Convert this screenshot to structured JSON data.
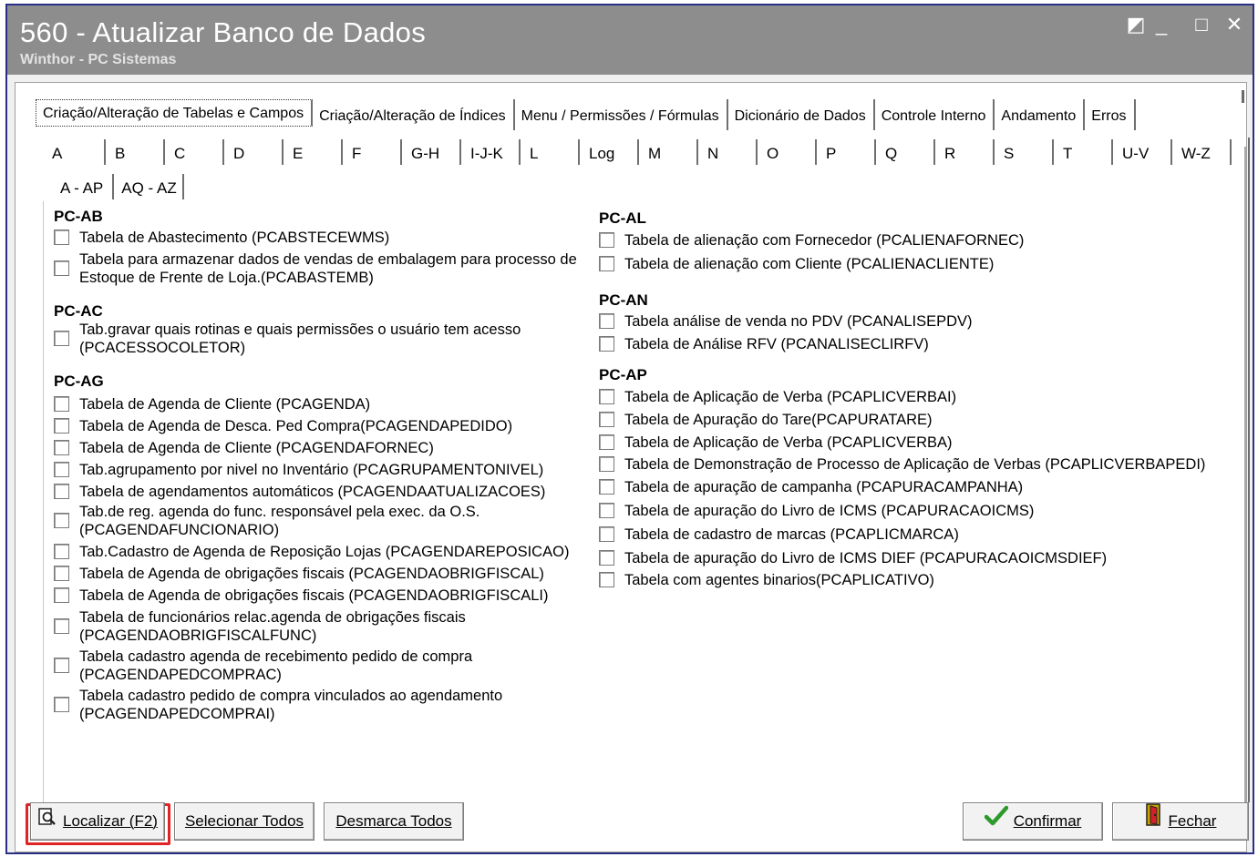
{
  "window": {
    "title": "560 - Atualizar Banco de Dados",
    "subtitle": "Winthor - PC Sistemas",
    "controls": {
      "restore": "◩",
      "minimize": "_",
      "maximize": "□",
      "close": "✕"
    }
  },
  "main_tabs": [
    "Criação/Alteração de Tabelas e Campos",
    "Criação/Alteração de Índices",
    "Menu / Permissões / Fórmulas",
    "Dicionário de Dados",
    "Controle Interno",
    "Andamento",
    "Erros"
  ],
  "letter_tabs": [
    "A",
    "B",
    "C",
    "D",
    "E",
    "F",
    "G-H",
    "I-J-K",
    "L",
    "Log",
    "M",
    "N",
    "O",
    "P",
    "Q",
    "R",
    "S",
    "T",
    "U-V",
    "W-Z"
  ],
  "sub_tabs": [
    "A - AP",
    "AQ - AZ"
  ],
  "groups": {
    "pcab": {
      "title": "PC-AB",
      "items": [
        "Tabela de Abastecimento (PCABSTECEWMS)",
        "Tabela para armazenar dados de vendas de embalagem para processo de Estoque de Frente de Loja.(PCABASTEMB)"
      ]
    },
    "pcac": {
      "title": "PC-AC",
      "items": [
        "Tab.gravar quais rotinas e quais permissões o usuário tem acesso (PCACESSOCOLETOR)"
      ]
    },
    "pcag": {
      "title": "PC-AG",
      "items": [
        "Tabela  de Agenda de Cliente (PCAGENDA)",
        "Tabela  de Agenda de Desca. Ped Compra(PCAGENDAPEDIDO)",
        "Tabela  de Agenda de Cliente (PCAGENDAFORNEC)",
        "Tab.agrupamento por nivel no Inventário (PCAGRUPAMENTONIVEL)",
        "Tabela de agendamentos automáticos (PCAGENDAATUALIZACOES)",
        "Tab.de reg. agenda do func. responsável pela exec. da O.S. (PCAGENDAFUNCIONARIO)",
        "Tab.Cadastro de Agenda de Reposição Lojas (PCAGENDAREPOSICAO)",
        "Tabela de Agenda de obrigações fiscais (PCAGENDAOBRIGFISCAL)",
        "Tabela de Agenda de obrigações fiscais (PCAGENDAOBRIGFISCALI)",
        "Tabela de funcionários relac.agenda de obrigações fiscais (PCAGENDAOBRIGFISCALFUNC)",
        "Tabela cadastro agenda de recebimento pedido de compra (PCAGENDAPEDCOMPRAC)",
        "Tabela cadastro pedido de compra vinculados ao agendamento (PCAGENDAPEDCOMPRAI)"
      ]
    },
    "pcal": {
      "title": "PC-AL",
      "items": [
        "Tabela de alienação com Fornecedor (PCALIENAFORNEC)",
        "Tabela de alienação com Cliente (PCALIENACLIENTE)"
      ]
    },
    "pcan": {
      "title": "PC-AN",
      "items": [
        "Tabela análise de venda no PDV (PCANALISEPDV)",
        "Tabela de Análise RFV (PCANALISECLIRFV)"
      ]
    },
    "pcap": {
      "title": "PC-AP",
      "items": [
        "Tabela de Aplicação de Verba (PCAPLICVERBAI)",
        "Tabela de Apuração do Tare(PCAPURATARE)",
        "Tabela de Aplicação de Verba (PCAPLICVERBA)",
        "Tabela de Demonstração de Processo de Aplicação de Verbas (PCAPLICVERBAPEDI)",
        "Tabela de apuração de campanha (PCAPURACAMPANHA)",
        "Tabela de apuração do Livro de ICMS (PCAPURACAOICMS)",
        "Tabela de cadastro de marcas (PCAPLICMARCA)",
        "Tabela de apuração do Livro de ICMS DIEF (PCAPURACAOICMSDIEF)",
        "Tabela com agentes binarios(PCAPLICATIVO)"
      ]
    }
  },
  "buttons": {
    "localizar": "Localizar (F2)",
    "selecionar": "Selecionar Todos",
    "desmarca": "Desmarca Todos",
    "confirmar": "Confirmar",
    "fechar": "Fechar"
  },
  "icons": {
    "localizar": "magnifier-page-icon",
    "confirmar": "checkmark-icon",
    "fechar": "exit-door-icon"
  },
  "colors": {
    "titlebar": "#8d8d8d",
    "window_border": "#2a2f86",
    "highlight": "#e02424",
    "check": "#2d9a2d"
  }
}
